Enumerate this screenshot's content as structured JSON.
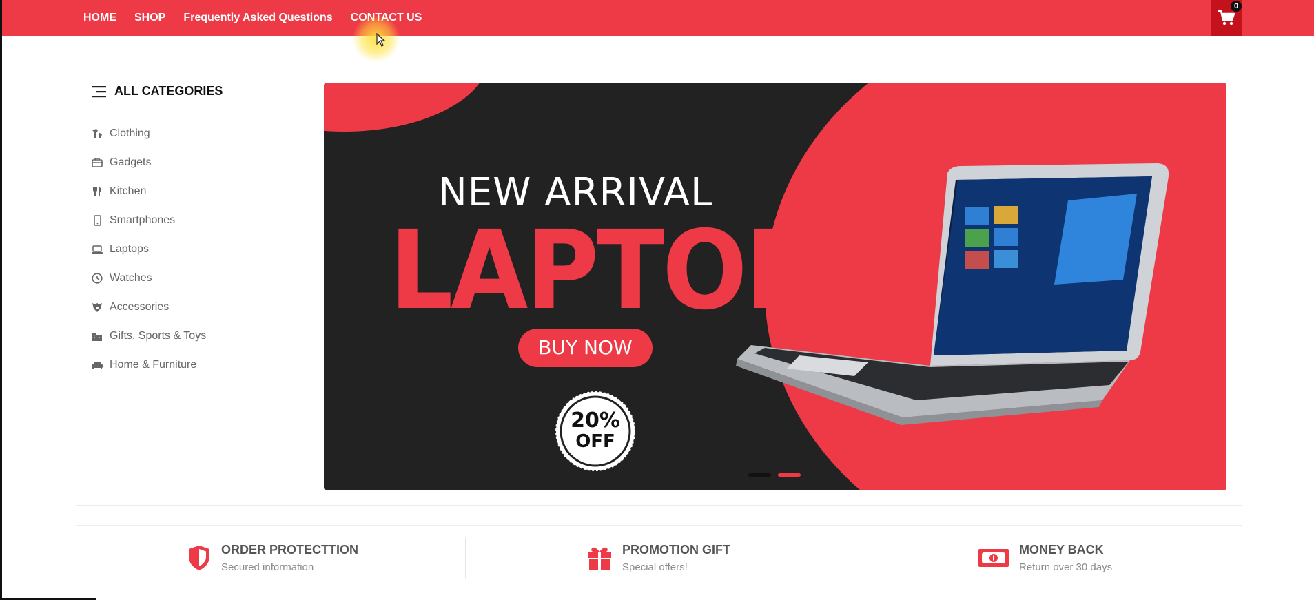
{
  "nav": {
    "links": [
      "HOME",
      "SHOP",
      "Frequently Asked Questions",
      "CONTACT US"
    ],
    "cart_count": "0",
    "cart_icon": "cart-icon"
  },
  "categories": {
    "title": "ALL CATEGORIES",
    "title_icon": "menu-icon",
    "items": [
      {
        "label": "Clothing",
        "icon": "clothing-icon"
      },
      {
        "label": "Gadgets",
        "icon": "briefcase-icon"
      },
      {
        "label": "Kitchen",
        "icon": "utensils-icon"
      },
      {
        "label": "Smartphones",
        "icon": "smartphone-icon"
      },
      {
        "label": "Laptops",
        "icon": "laptop-icon"
      },
      {
        "label": "Watches",
        "icon": "clock-icon"
      },
      {
        "label": "Accessories",
        "icon": "accessories-icon"
      },
      {
        "label": "Gifts, Sports & Toys",
        "icon": "building-icon"
      },
      {
        "label": "Home & Furniture",
        "icon": "couch-icon"
      }
    ]
  },
  "banner": {
    "subtitle": "NEW ARRIVAL",
    "headline": "LAPTOP",
    "cta": "BUY NOW",
    "badge_percent": "20%",
    "badge_text": "OFF",
    "slides_total": 2,
    "active_slide": 2
  },
  "features": [
    {
      "title": "ORDER PROTECTTION",
      "subtitle": "Secured information",
      "icon": "shield-icon"
    },
    {
      "title": "PROMOTION GIFT",
      "subtitle": "Special offers!",
      "icon": "gift-icon"
    },
    {
      "title": "MONEY BACK",
      "subtitle": "Return over 30 days",
      "icon": "money-icon"
    }
  ],
  "colors": {
    "brand_red": "#ee3a46",
    "cart_red": "#c4121d",
    "banner_dark": "#222222"
  }
}
